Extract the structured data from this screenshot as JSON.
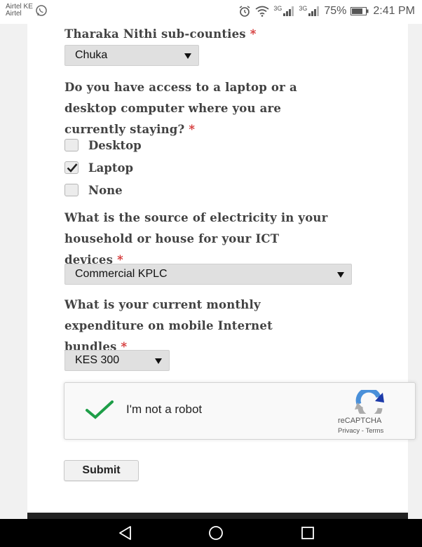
{
  "status_bar": {
    "carrier_primary": "Airtel KE",
    "carrier_secondary": "Airtel",
    "network_1": "3G",
    "network_2": "3G",
    "battery": "75%",
    "time": "2:41 PM"
  },
  "form": {
    "subcounty": {
      "label": "Tharaka Nithi sub-counties",
      "required_mark": "*",
      "selected": "Chuka"
    },
    "computer_access": {
      "label_line1": "Do you have access to a laptop or a",
      "label_line2": "desktop computer where you are",
      "label_line3": "currently staying?",
      "required_mark": "*",
      "options": [
        {
          "label": "Desktop",
          "checked": false
        },
        {
          "label": "Laptop",
          "checked": true
        },
        {
          "label": "None",
          "checked": false
        }
      ]
    },
    "electricity_source": {
      "label_line1": "What is the source of electricity in your",
      "label_line2": "household or house for your ICT",
      "label_line3": "devices",
      "required_mark": "*",
      "selected": "Commercial KPLC"
    },
    "internet_expenditure": {
      "label_line1": "What is your current monthly",
      "label_line2": "expenditure on mobile Internet",
      "label_line3": "bundles",
      "required_mark": "*",
      "selected": "KES 300"
    },
    "recaptcha": {
      "label": "I'm not a robot",
      "brand": "reCAPTCHA",
      "privacy": "Privacy",
      "separator": " - ",
      "terms": "Terms",
      "checked": true
    },
    "submit_label": "Submit"
  },
  "colors": {
    "required": "#d32f2f",
    "check_green": "#1e9e48",
    "select_bg": "#e0e0e0"
  },
  "icons": {
    "status": [
      "whatsapp-icon",
      "alarm-icon",
      "wifi-icon",
      "signal-icon",
      "battery-icon"
    ],
    "nav": [
      "back-icon",
      "home-icon",
      "recents-icon"
    ]
  }
}
